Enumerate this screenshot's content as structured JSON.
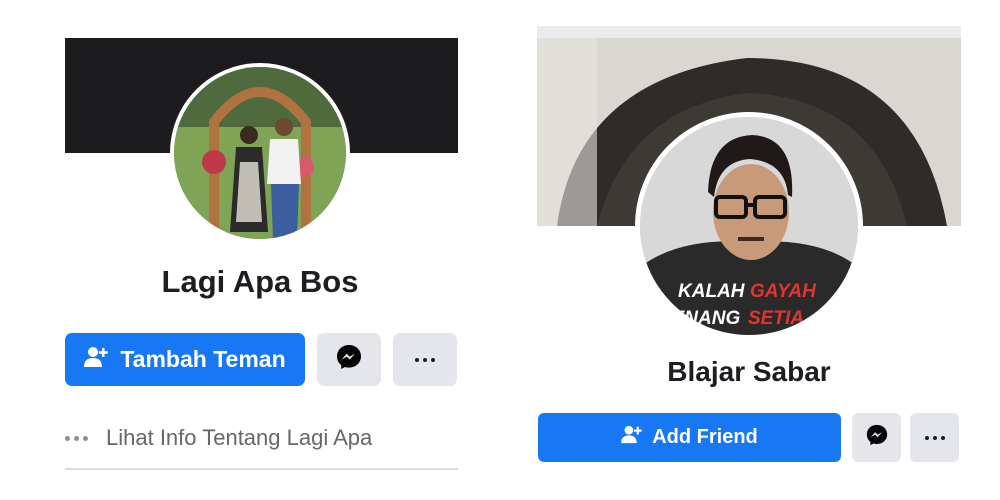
{
  "left_profile": {
    "name": "Lagi Apa Bos",
    "add_friend_label": "Tambah Teman",
    "info_label": "Lihat Info Tentang Lagi Apa"
  },
  "right_profile": {
    "name": "Blajar Sabar",
    "add_friend_label": "Add Friend",
    "avatar_caption_line1_a": "KALAH",
    "avatar_caption_line1_b": "GAYAH",
    "avatar_caption_line2_a": "TENANG",
    "avatar_caption_line2_b": "SETIA"
  },
  "colors": {
    "primary_button": "#1877f2",
    "secondary_button": "#e4e6eb",
    "left_cover": "#1c1c1e"
  },
  "icons": [
    "add-friend-icon",
    "messenger-icon",
    "more-options-icon"
  ]
}
